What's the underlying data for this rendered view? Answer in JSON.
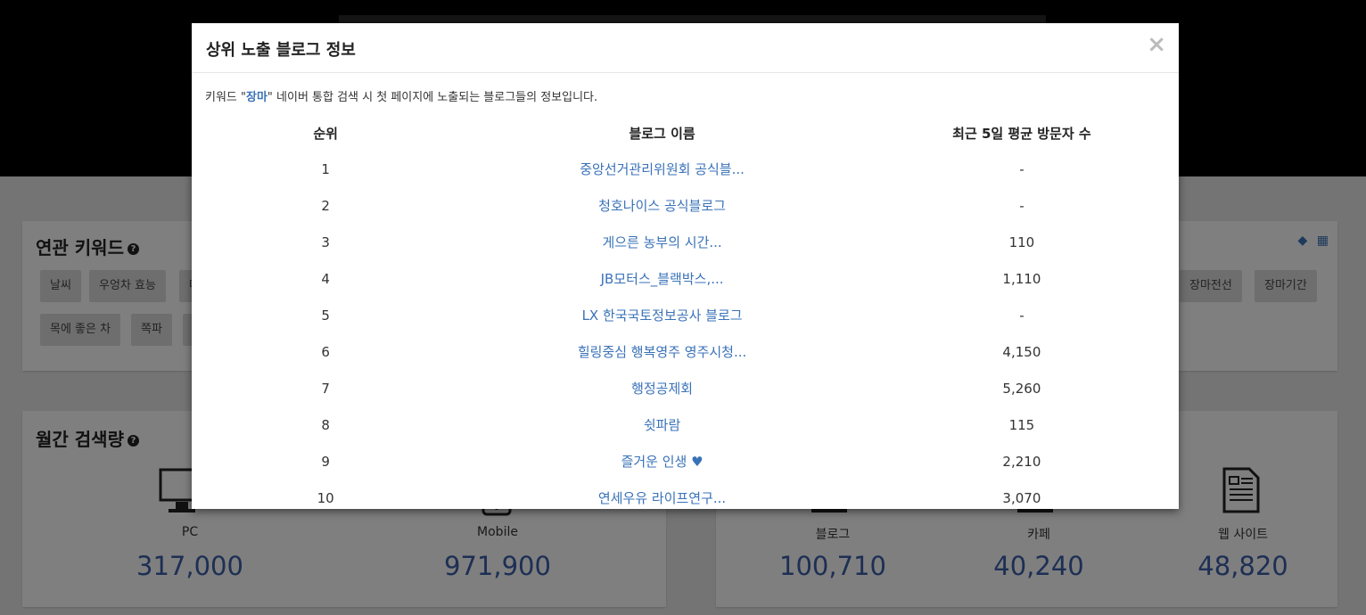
{
  "background": {
    "hero_subtitle": "",
    "related": {
      "title": "연관 키워드",
      "row1": [
        "날씨",
        "우엉차 효능",
        "마",
        "장마전선",
        "장마기간"
      ],
      "row2": [
        "목에 좋은 차",
        "쪽파",
        ""
      ]
    },
    "monthly": {
      "title": "월간 검색량",
      "stats": [
        {
          "label": "PC",
          "value": "317,000"
        },
        {
          "label": "Mobile",
          "value": "971,900"
        }
      ]
    },
    "content_counts": {
      "stats": [
        {
          "label": "블로그",
          "value": "100,710"
        },
        {
          "label": "카페",
          "value": "40,240"
        },
        {
          "label": "웹 사이트",
          "value": "48,820"
        }
      ]
    }
  },
  "modal": {
    "title": "상위 노출 블로그 정보",
    "close_label": "×",
    "desc_prefix": "키워드 \"",
    "keyword": "장마",
    "desc_suffix": "\" 네이버 통합 검색 시 첫 페이지에 노출되는 블로그들의 정보입니다.",
    "columns": {
      "rank": "순위",
      "name": "블로그 이름",
      "visitors": "최근 5일 평균 방문자 수"
    },
    "rows": [
      {
        "rank": "1",
        "name": "중앙선거관리위원회 공식블...",
        "visitors": "-"
      },
      {
        "rank": "2",
        "name": "청호나이스 공식블로그",
        "visitors": "-"
      },
      {
        "rank": "3",
        "name": "게으른 농부의 시간...",
        "visitors": "110"
      },
      {
        "rank": "4",
        "name": "JB모터스_블랙박스,...",
        "visitors": "1,110"
      },
      {
        "rank": "5",
        "name": "LX 한국국토정보공사 블로그",
        "visitors": "-"
      },
      {
        "rank": "6",
        "name": "힐링중심 행복영주 영주시청...",
        "visitors": "4,150"
      },
      {
        "rank": "7",
        "name": "행정공제회",
        "visitors": "5,260"
      },
      {
        "rank": "8",
        "name": "쉿파람",
        "visitors": "115"
      },
      {
        "rank": "9",
        "name": "즐거운 인생 ♥",
        "visitors": "2,210"
      },
      {
        "rank": "10",
        "name": "연세우유 라이프연구...",
        "visitors": "3,070"
      }
    ]
  },
  "icons": {
    "help": "question-circle-icon",
    "tags": "tags-icon",
    "grid": "grid-icon",
    "pc": "monitor-icon",
    "mobile": "phone-icon",
    "blog": "laptop-icon",
    "cafe": "laptop-icon",
    "web": "document-icon"
  },
  "colors": {
    "accent": "#3a72b8",
    "stat_value": "#3a5ea8",
    "overlay": "rgba(0,0,0,0.5)"
  }
}
